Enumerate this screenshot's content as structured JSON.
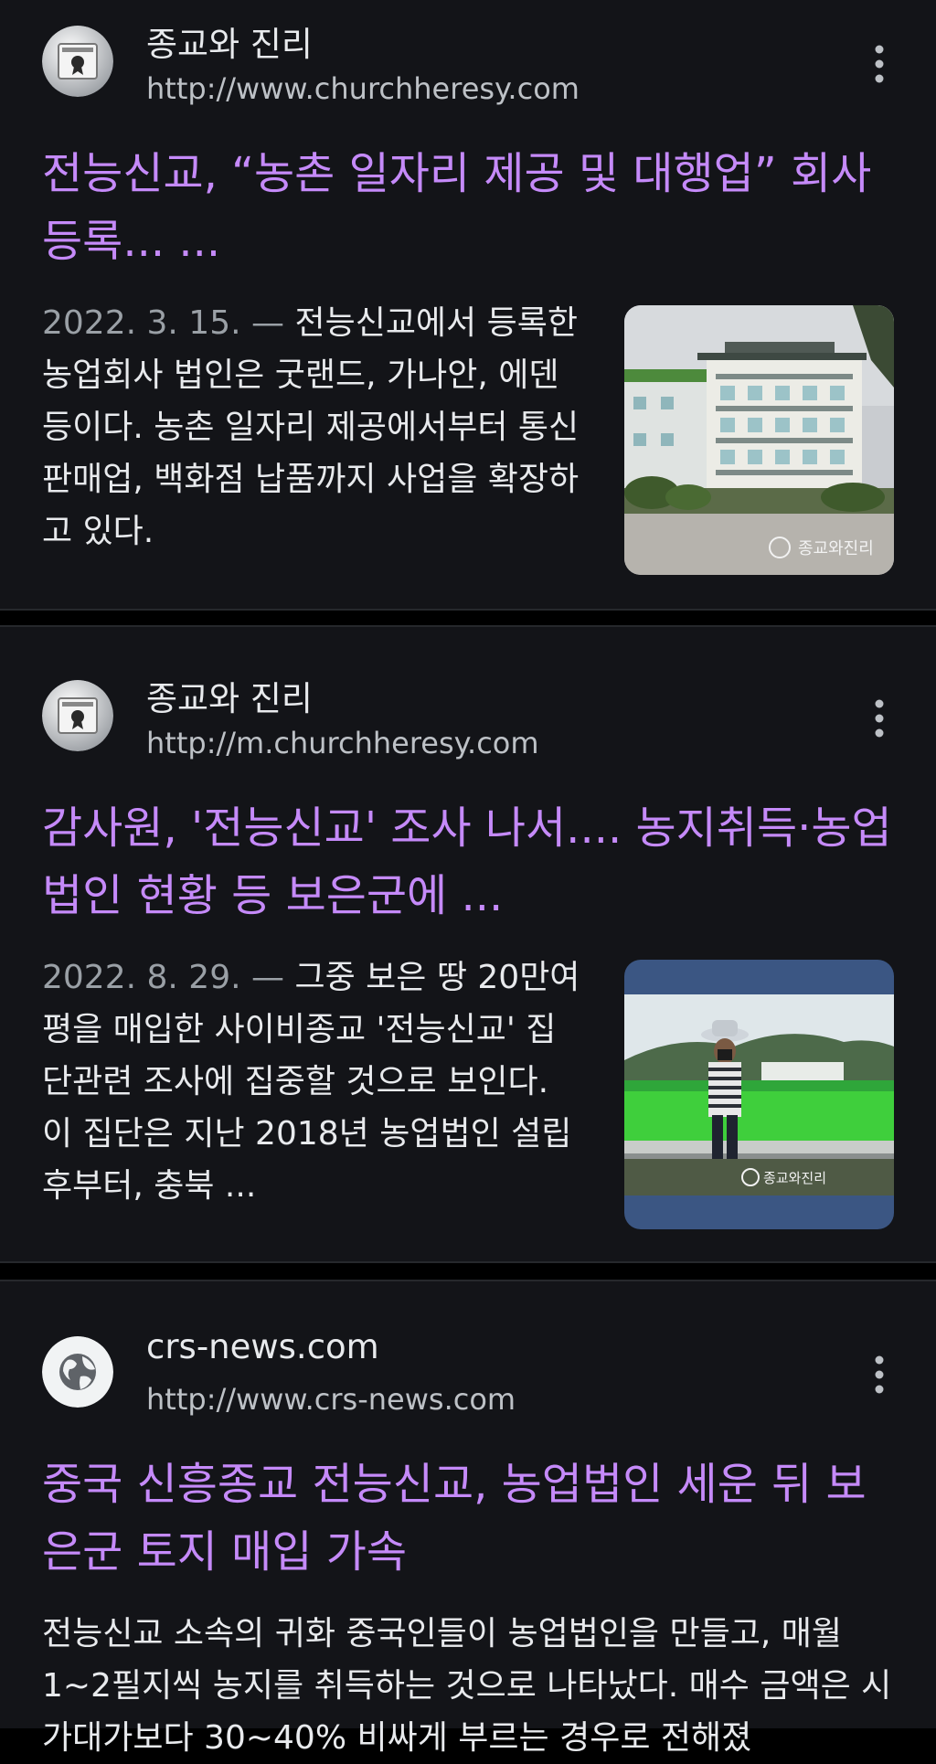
{
  "results": [
    {
      "site_name": "종교와 진리",
      "site_url": "http://www.churchheresy.com",
      "favicon": "newspaper-certificate-icon",
      "title": "전능신교, “농촌 일자리 제공 및 대행업” 회사 등록... ...",
      "date": "2022. 3. 15. —",
      "snippet": "전능신교에서 등록한 농업회사 법인은 굿랜드, 가나안, 에덴 등이다. 농촌 일자리 제공에서부터 통신 판매업, 백화점 납품까지 사업을 확장하고 있다.",
      "thumbnail_watermark": "종교와진리",
      "thumbnail_subject": "apartment-building-photo"
    },
    {
      "site_name": "종교와 진리",
      "site_url": "http://m.churchheresy.com",
      "favicon": "newspaper-certificate-icon",
      "title": "감사원, '전능신교' 조사 나서.... 농지취득·농업법인 현황 등 보은군에 ...",
      "date": "2022. 8. 29. —",
      "snippet": "그중 보은 땅 20만여 평을 매입한 사이비종교 '전능신교' 집단관련 조사에 집중할 것으로 보인다. 이 집단은 지난 2018년 농업법인 설립 후부터, 충북 ...",
      "thumbnail_watermark": "종교와진리",
      "thumbnail_subject": "man-in-rice-field-photo"
    },
    {
      "site_name": "crs-news.com",
      "site_url": "http://www.crs-news.com",
      "favicon": "globe-icon",
      "title": "중국 신흥종교 전능신교, 농업법인 세운 뒤 보은군 토지 매입 가속",
      "snippet": "전능신교 소속의 귀화 중국인들이 농업법인을 만들고, 매월 1~2필지씩 농지를 취득하는 것으로 나타났다. 매수 금액은 시가대가보다 30~40% 비싸게 부르는 경우로 전해졌"
    }
  ],
  "colors": {
    "background": "#131418",
    "divider": "#000000",
    "title_link": "#c58af9",
    "body_text": "#e8eaed",
    "secondary_text": "#9aa0a6"
  }
}
